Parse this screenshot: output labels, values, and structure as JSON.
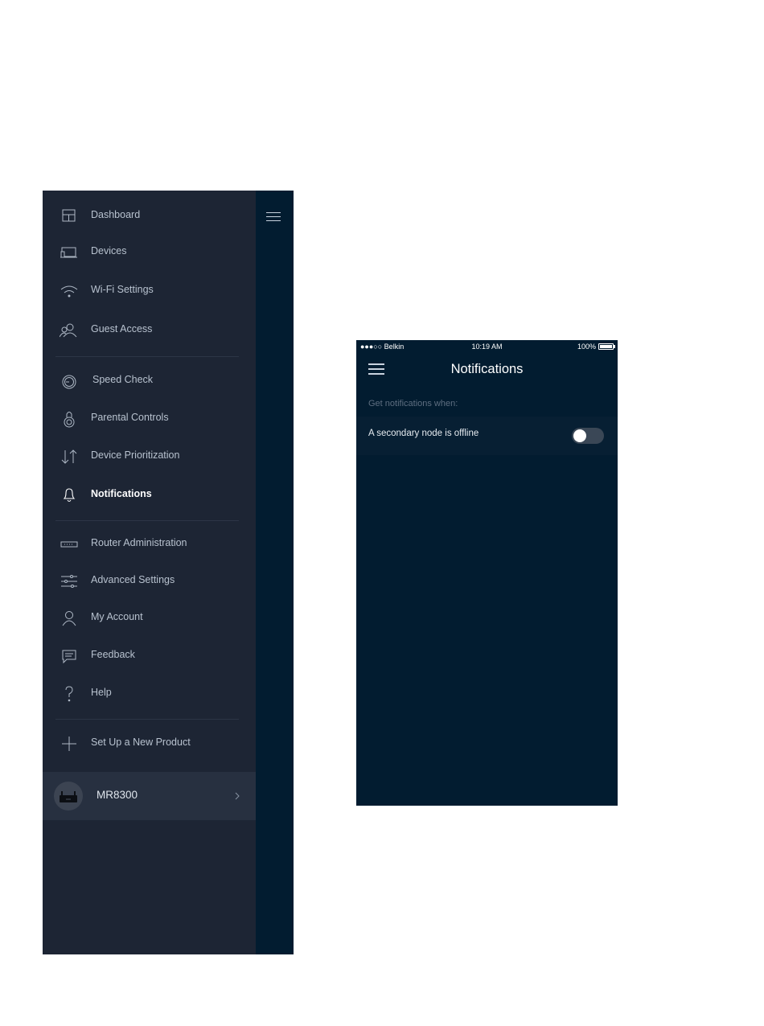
{
  "menu": {
    "items": [
      {
        "label": "Dashboard",
        "icon": "dashboard-icon"
      },
      {
        "label": "Devices",
        "icon": "devices-icon"
      },
      {
        "label": "Wi-Fi Settings",
        "icon": "wifi-icon"
      },
      {
        "label": "Guest Access",
        "icon": "guest-access-icon"
      },
      {
        "label": "Speed Check",
        "icon": "speedometer-icon"
      },
      {
        "label": "Parental Controls",
        "icon": "parental-controls-icon"
      },
      {
        "label": "Device Prioritization",
        "icon": "arrows-up-down-icon"
      },
      {
        "label": "Notifications",
        "icon": "bell-icon",
        "active": true
      },
      {
        "label": "Router Administration",
        "icon": "router-icon"
      },
      {
        "label": "Advanced Settings",
        "icon": "sliders-icon"
      },
      {
        "label": "My Account",
        "icon": "user-icon"
      },
      {
        "label": "Feedback",
        "icon": "chat-icon"
      },
      {
        "label": "Help",
        "icon": "question-icon"
      },
      {
        "label": "Set Up a New Product",
        "icon": "plus-icon"
      }
    ],
    "device": {
      "name": "MR8300"
    }
  },
  "phone": {
    "status_bar": {
      "carrier": "●●●○○ Belkin",
      "time": "10:19 AM",
      "battery": "100%"
    },
    "title": "Notifications",
    "section_label": "Get notifications when:",
    "settings": [
      {
        "label": "A secondary node is offline",
        "enabled": false
      }
    ]
  },
  "colors": {
    "drawer_bg": "#1d2534",
    "app_bg": "#021c30",
    "active_text": "#ffffff",
    "inactive_text": "#b8c2cf"
  }
}
